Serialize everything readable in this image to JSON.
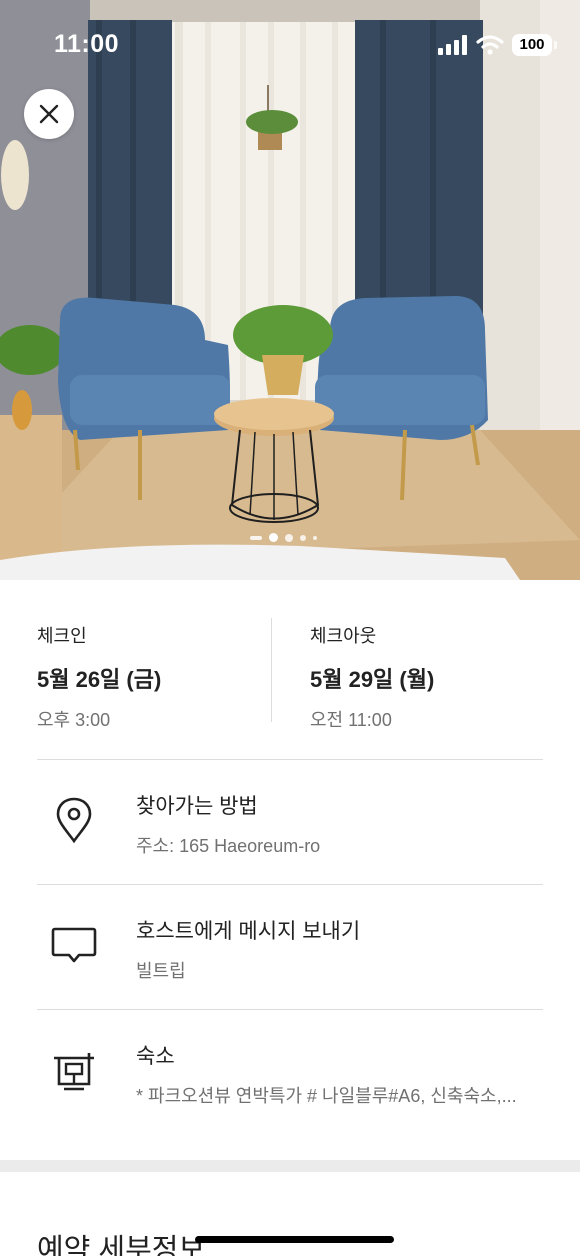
{
  "status_bar": {
    "time": "11:00",
    "battery": "100"
  },
  "hero": {
    "photo_count": 5,
    "current_photo": 1
  },
  "checkin": {
    "label": "체크인",
    "date": "5월 26일 (금)",
    "time": "오후 3:00"
  },
  "checkout": {
    "label": "체크아웃",
    "date": "5월 29일 (월)",
    "time": "오전 11:00"
  },
  "rows": [
    {
      "icon": "location-pin-icon",
      "title": "찾아가는 방법",
      "subtitle": "주소: 165 Haeoreum-ro"
    },
    {
      "icon": "message-icon",
      "title": "호스트에게 메시지 보내기",
      "subtitle": "빌트립"
    },
    {
      "icon": "listing-icon",
      "title": "숙소",
      "subtitle": "* 파크오션뷰 연박특가 # 나일블루#A6, 신축숙소,..."
    }
  ],
  "details": {
    "heading": "예약 세부정보"
  },
  "colors": {
    "text": "#222222",
    "muted": "#717171",
    "divider": "#dddddd",
    "section_gap": "#ebebeb"
  }
}
